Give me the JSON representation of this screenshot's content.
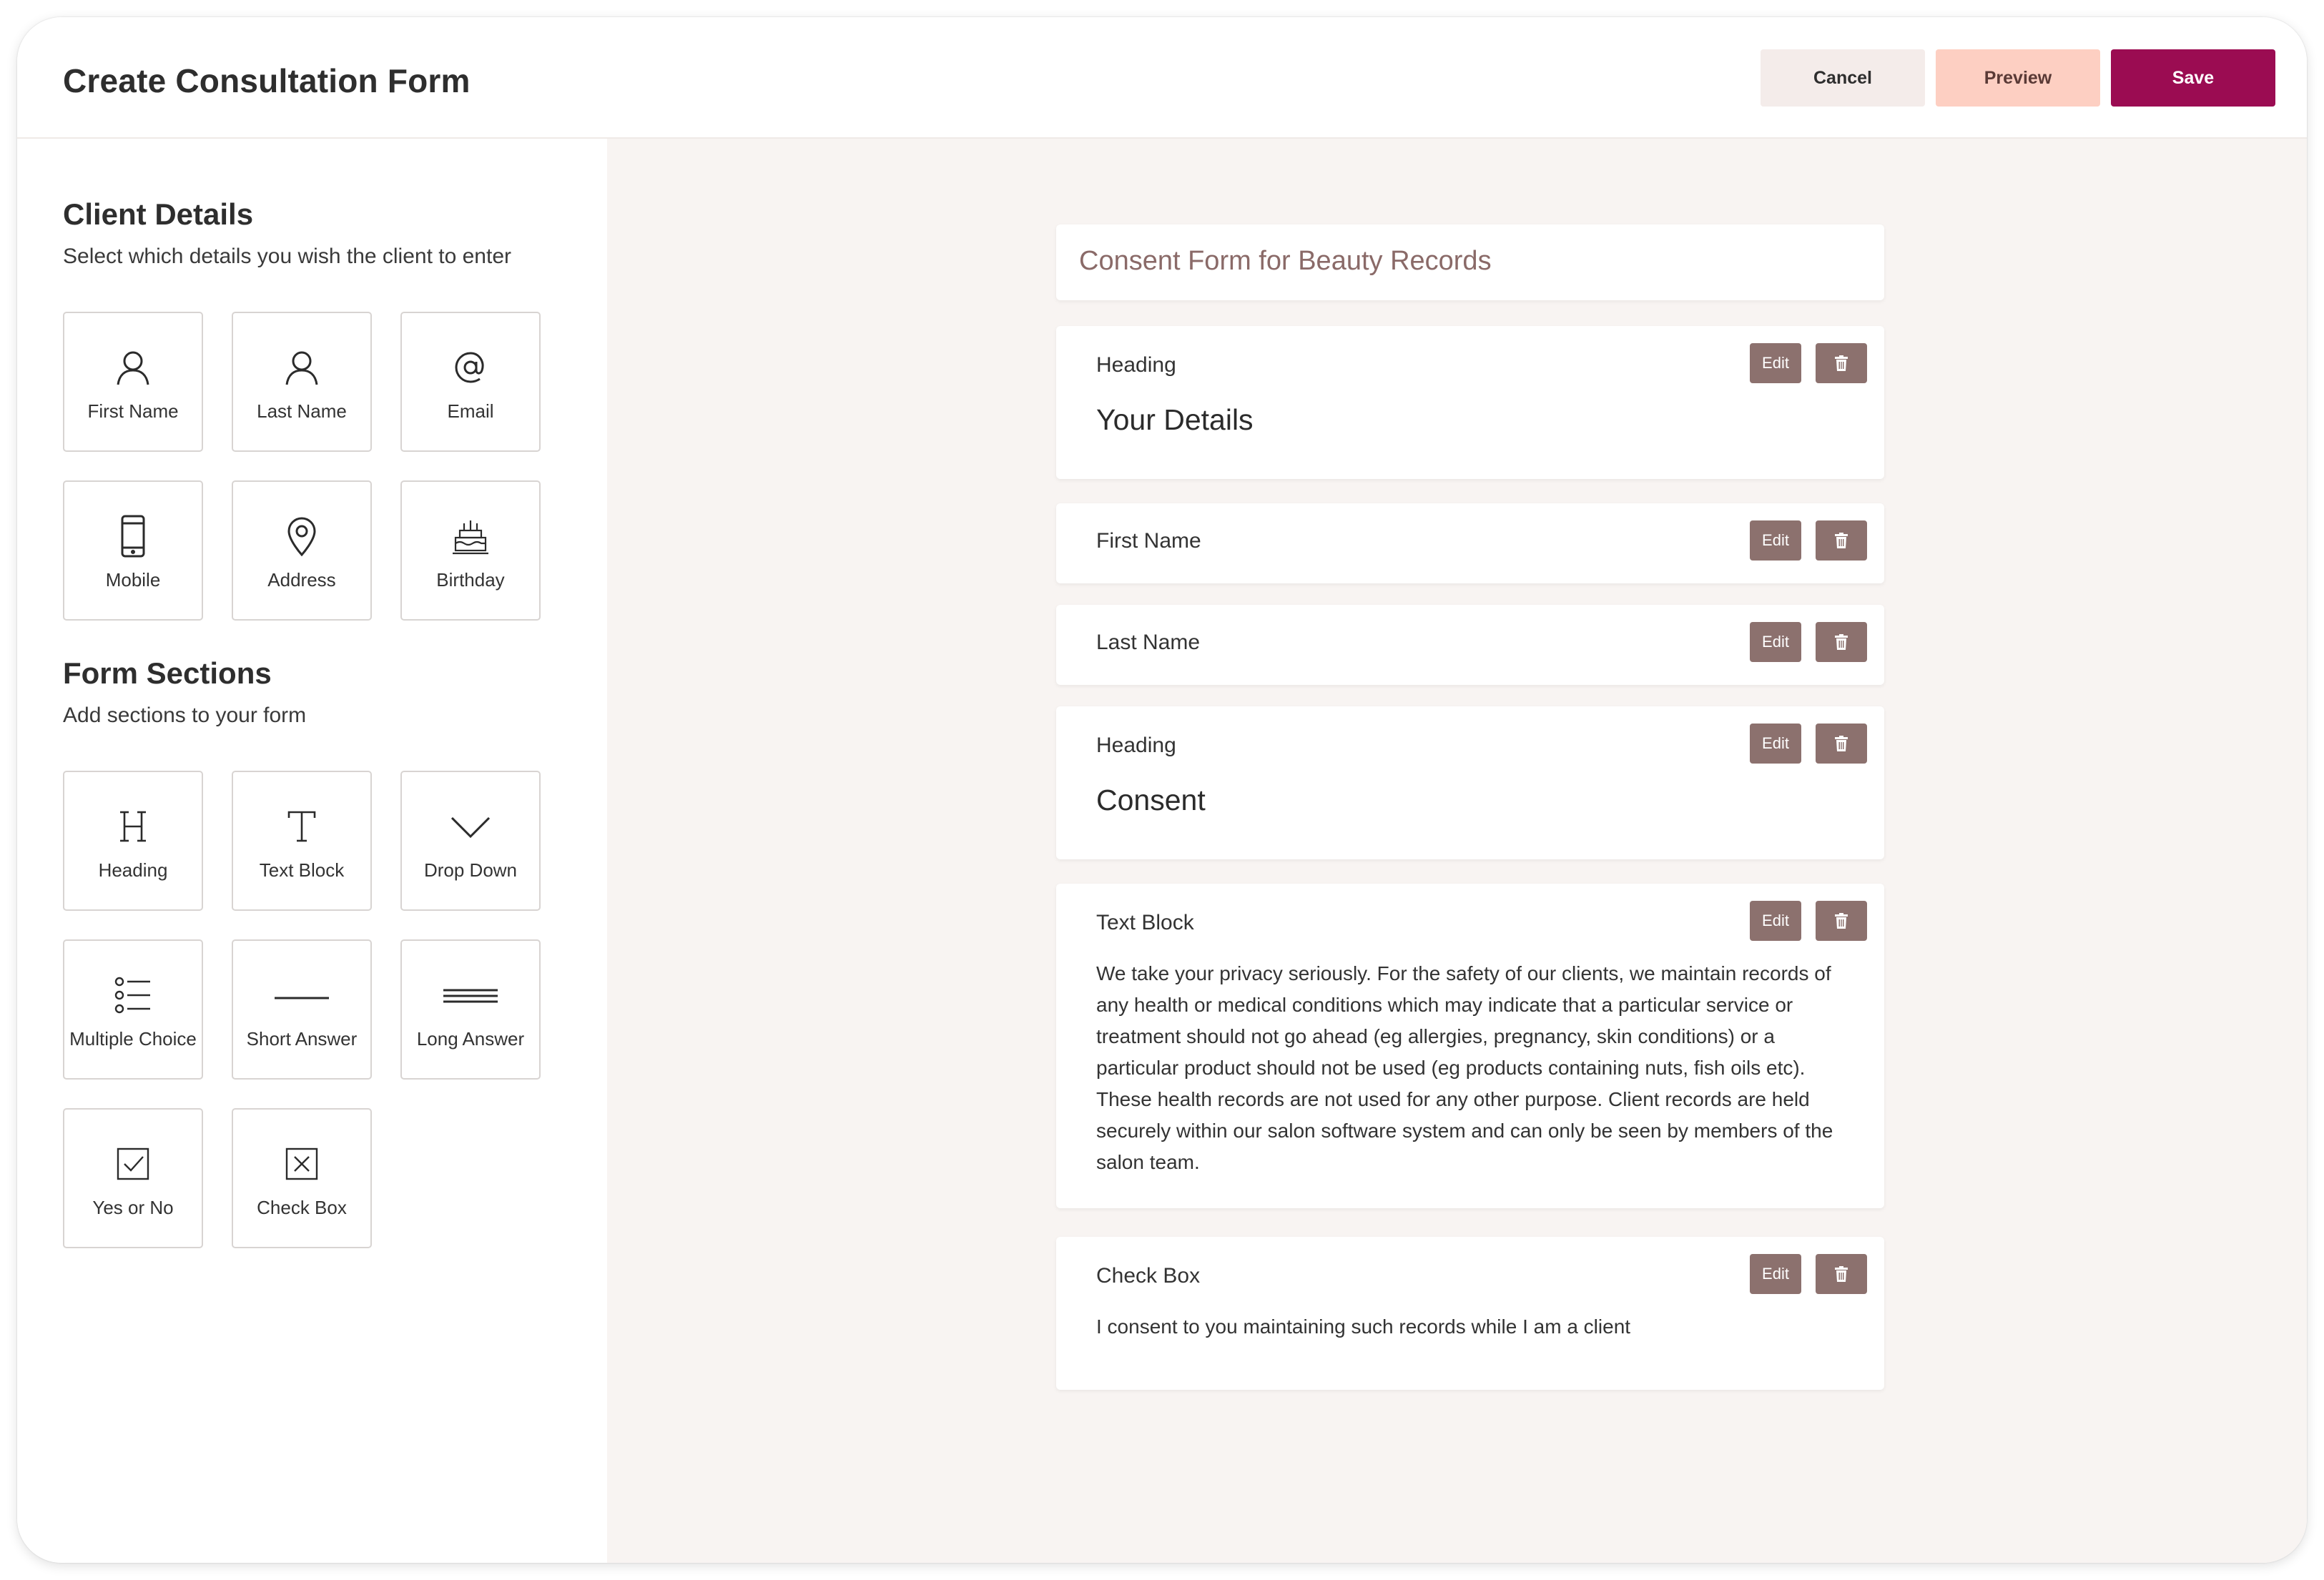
{
  "header": {
    "title": "Create Consultation Form",
    "cancel_label": "Cancel",
    "preview_label": "Preview",
    "save_label": "Save"
  },
  "client_details": {
    "title": "Client Details",
    "subtitle": "Select which details you wish the client to enter",
    "items": [
      {
        "label": "First Name",
        "icon": "person-icon"
      },
      {
        "label": "Last Name",
        "icon": "person-icon"
      },
      {
        "label": "Email",
        "icon": "at-sign-icon"
      },
      {
        "label": "Mobile",
        "icon": "mobile-phone-icon"
      },
      {
        "label": "Address",
        "icon": "location-pin-icon"
      },
      {
        "label": "Birthday",
        "icon": "birthday-cake-icon"
      }
    ]
  },
  "form_sections": {
    "title": "Form Sections",
    "subtitle": "Add sections to your form",
    "items": [
      {
        "label": "Heading",
        "icon": "heading-h-icon"
      },
      {
        "label": "Text Block",
        "icon": "text-t-icon"
      },
      {
        "label": "Drop Down",
        "icon": "chevron-down-icon"
      },
      {
        "label": "Multiple Choice",
        "icon": "list-bullets-icon"
      },
      {
        "label": "Short Answer",
        "icon": "short-line-icon"
      },
      {
        "label": "Long Answer",
        "icon": "long-lines-icon"
      },
      {
        "label": "Yes or No",
        "icon": "checkbox-checked-icon"
      },
      {
        "label": "Check Box",
        "icon": "checkbox-x-icon"
      }
    ]
  },
  "form": {
    "title": "Consent Form for Beauty Records",
    "edit_label": "Edit",
    "blocks": [
      {
        "type": "Heading",
        "content": "Your Details"
      },
      {
        "type": "First Name"
      },
      {
        "type": "Last Name"
      },
      {
        "type": "Heading",
        "content": "Consent"
      },
      {
        "type": "Text Block",
        "content": "We take your privacy seriously. For the safety of our clients, we maintain records of any health or medical conditions which may indicate that a particular service or treatment should not go ahead (eg allergies, pregnancy, skin conditions) or a particular product should not be used (eg products containing nuts, fish oils etc). These health records are not used for any other purpose. Client records are held securely within our salon software system and can only be seen by members of the salon team."
      },
      {
        "type": "Check Box",
        "content": "I consent to you maintaining such records while I am a client"
      }
    ]
  },
  "colors": {
    "primary": "#9b0c52",
    "preview_bg": "#fdcfc2",
    "cancel_bg": "#f4ecea",
    "action_button": "#8c716e",
    "canvas_bg": "#f8f4f2"
  }
}
